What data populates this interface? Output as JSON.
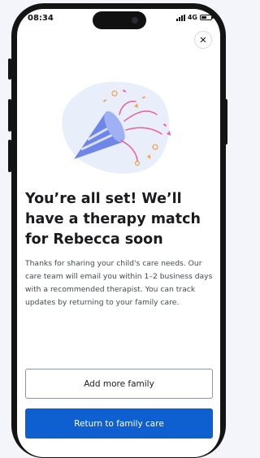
{
  "status_bar": {
    "time": "08:34",
    "network": "4G",
    "icons": [
      "signal-icon",
      "battery-icon"
    ]
  },
  "close_icon": "close-icon",
  "illustration": "party-popper-illustration",
  "content": {
    "title": "You’re all set! We’ll have a therapy match for Rebecca soon",
    "body": "Thanks for sharing your child's care needs. Our care team will email you within 1–2 business days with a recommended therapist. You can track updates by returning to your family care."
  },
  "actions": {
    "secondary_label": "Add more family",
    "primary_label": "Return to family care"
  },
  "colors": {
    "primary": "#0e5fcf",
    "confetti_pink": "#f0659b",
    "confetti_orange": "#f2a65a",
    "popper_blue": "#6d86e8",
    "background_blob": "#e9eefb"
  }
}
